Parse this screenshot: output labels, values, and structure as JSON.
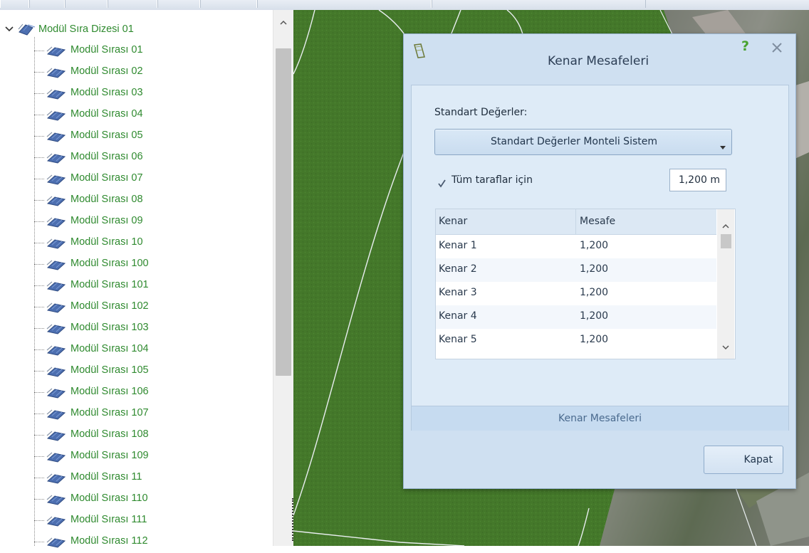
{
  "tree": {
    "root_label": "Modül Sıra Dizesi 01",
    "items": [
      "Modül Sırası 01",
      "Modül Sırası 02",
      "Modül Sırası 03",
      "Modül Sırası 04",
      "Modül Sırası 05",
      "Modül Sırası 06",
      "Modül Sırası 07",
      "Modül Sırası 08",
      "Modül Sırası 09",
      "Modül Sırası 10",
      "Modül Sırası 100",
      "Modül Sırası 101",
      "Modül Sırası 102",
      "Modül Sırası 103",
      "Modül Sırası 104",
      "Modül Sırası 105",
      "Modül Sırası 106",
      "Modül Sırası 107",
      "Modül Sırası 108",
      "Modül Sırası 109",
      "Modül Sırası 11",
      "Modül Sırası 110",
      "Modül Sırası 111",
      "Modül Sırası 112"
    ]
  },
  "dialog": {
    "title": "Kenar Mesafeleri",
    "help": "?",
    "standard_label": "Standart Değerler:",
    "standard_value": "Standart Değerler Monteli Sistem",
    "all_sides_label": "Tüm taraflar için",
    "all_sides_checked": true,
    "all_sides_value": "1,200 m",
    "grid": {
      "headers": [
        "Kenar",
        "Mesafe"
      ],
      "rows": [
        [
          "Kenar 1",
          "1,200"
        ],
        [
          "Kenar 2",
          "1,200"
        ],
        [
          "Kenar 3",
          "1,200"
        ],
        [
          "Kenar 4",
          "1,200"
        ],
        [
          "Kenar 5",
          "1,200"
        ]
      ]
    },
    "footer_tab": "Kenar Mesafeleri",
    "close_button": "Kapat"
  },
  "icons": {
    "tree_expand": "chevron-down-icon",
    "tree_node": "solar-module-icon",
    "dialog": "roof-edge-icon",
    "close": "close-icon"
  },
  "colors": {
    "tree_text": "#2f8a2f",
    "map_field": "#44782a",
    "dialog_bg": "#cfe0f1",
    "help": "#48a22f"
  }
}
